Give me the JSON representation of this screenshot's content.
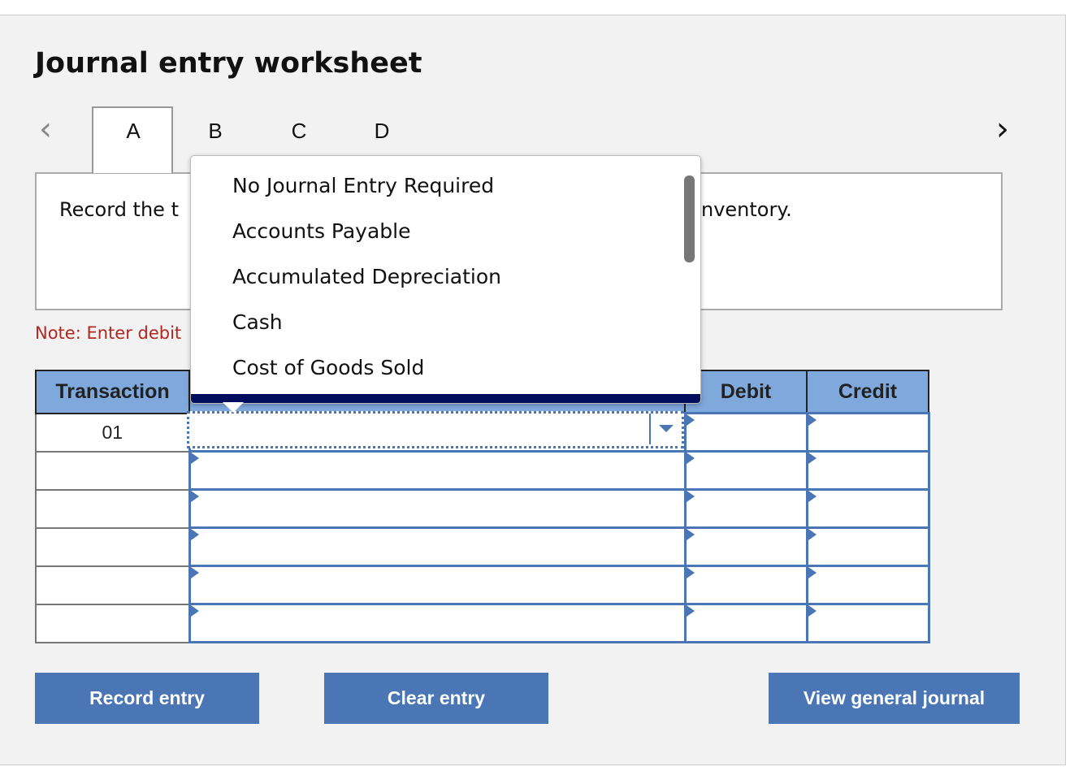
{
  "title": "Journal entry worksheet",
  "tabs": [
    "A",
    "B",
    "C",
    "D"
  ],
  "active_tab": "A",
  "nav": {
    "prev_icon": "chevron-left-icon",
    "next_icon": "chevron-right-icon",
    "prev": "‹",
    "next": "›"
  },
  "instruction": {
    "visible_start": "Record the t",
    "visible_end": "nventory."
  },
  "note": "Note: Enter debit",
  "table": {
    "headers": {
      "transaction": "Transaction",
      "debit": "Debit",
      "credit": "Credit"
    },
    "rows": [
      {
        "transaction": "01",
        "account": "",
        "debit": "",
        "credit": ""
      },
      {
        "transaction": "",
        "account": "",
        "debit": "",
        "credit": ""
      },
      {
        "transaction": "",
        "account": "",
        "debit": "",
        "credit": ""
      },
      {
        "transaction": "",
        "account": "",
        "debit": "",
        "credit": ""
      },
      {
        "transaction": "",
        "account": "",
        "debit": "",
        "credit": ""
      },
      {
        "transaction": "",
        "account": "",
        "debit": "",
        "credit": ""
      }
    ]
  },
  "dropdown": {
    "options": [
      "No Journal Entry Required",
      "Accounts Payable",
      "Accumulated Depreciation",
      "Cash",
      "Cost of Goods Sold"
    ]
  },
  "buttons": {
    "record": "Record entry",
    "clear": "Clear entry",
    "view": "View general journal"
  },
  "colors": {
    "accent": "#4a76b5",
    "header": "#7fa8dd",
    "note": "#b0281f",
    "dropdown_bar": "#000c5c"
  }
}
